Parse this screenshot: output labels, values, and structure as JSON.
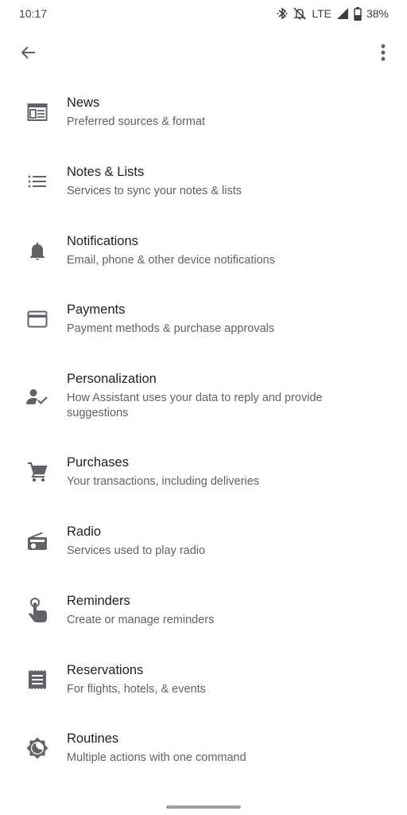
{
  "status_bar": {
    "time": "10:17",
    "network": "LTE",
    "battery": "38%",
    "icons": [
      "bluetooth-icon",
      "notifications-off-icon",
      "signal-icon",
      "battery-icon"
    ]
  },
  "toolbar": {
    "back_icon": "arrow-back-icon",
    "more_icon": "more-vert-icon"
  },
  "items": [
    {
      "title": "News",
      "subtitle": "Preferred sources & format",
      "icon": "news-icon"
    },
    {
      "title": "Notes & Lists",
      "subtitle": "Services to sync your notes & lists",
      "icon": "list-icon"
    },
    {
      "title": "Notifications",
      "subtitle": "Email, phone & other device notifications",
      "icon": "bell-icon"
    },
    {
      "title": "Payments",
      "subtitle": "Payment methods & purchase approvals",
      "icon": "credit-card-icon"
    },
    {
      "title": "Personalization",
      "subtitle": "How Assistant uses your data to reply and provide suggestions",
      "icon": "person-check-icon"
    },
    {
      "title": "Purchases",
      "subtitle": "Your transactions, including deliveries",
      "icon": "shopping-cart-icon"
    },
    {
      "title": "Radio",
      "subtitle": "Services used to play radio",
      "icon": "radio-icon"
    },
    {
      "title": "Reminders",
      "subtitle": "Create or manage reminders",
      "icon": "reminder-finger-icon"
    },
    {
      "title": "Reservations",
      "subtitle": "For flights, hotels, & events",
      "icon": "receipt-icon"
    },
    {
      "title": "Routines",
      "subtitle": "Multiple actions with one command",
      "icon": "routines-icon"
    }
  ],
  "colors": {
    "title": "#202124",
    "subtitle": "#5f6368",
    "icon": "#5f6368"
  }
}
